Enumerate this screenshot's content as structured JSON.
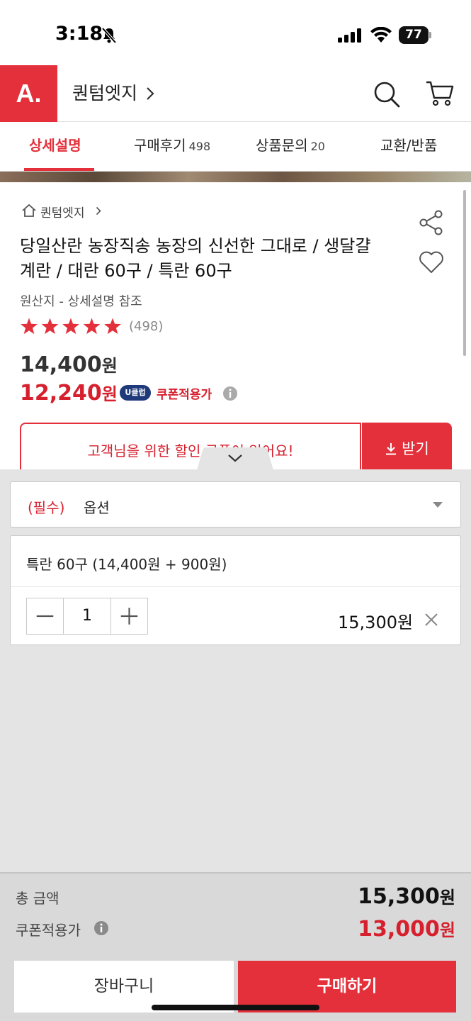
{
  "status_bar": {
    "time": "3:18",
    "battery": "77"
  },
  "header": {
    "store_name": "퀀텀엣지",
    "logo": "A."
  },
  "tabs": [
    {
      "label": "상세설명",
      "count": ""
    },
    {
      "label": "구매후기",
      "count": "498"
    },
    {
      "label": "상품문의",
      "count": "20"
    },
    {
      "label": "교환/반품",
      "count": ""
    }
  ],
  "product": {
    "breadcrumb": "퀀텀엣지",
    "title": "당일산란 농장직송 농장의 신선한 그대로 / 생달걀 계란 / 대란 60구 / 특란 60구",
    "origin": "원산지 - 상세설명 참조",
    "rating": 5,
    "review_count": "(498)",
    "original_price": "14,400",
    "sale_price": "12,240",
    "currency": "원",
    "badge": "U클럽",
    "coupon_applied_label": "쿠폰적용가",
    "coupon_banner": "고객님을 위한 할인 쿠폰이 있어요!",
    "coupon_button": "받기"
  },
  "options": {
    "required_tag": "(필수)",
    "option_label": "옵션",
    "selected": {
      "name": "특란 60구 (14,400원 + 900원)",
      "quantity": "1",
      "price": "15,300원"
    }
  },
  "totals": {
    "total_label": "총 금액",
    "total_value": "15,300",
    "coupon_label": "쿠폰적용가",
    "coupon_value": "13,000",
    "currency": "원"
  },
  "actions": {
    "cart": "장바구니",
    "buy": "구매하기"
  },
  "colors": {
    "brand": "#e4303b",
    "price_red": "#d6202e",
    "uclub_navy": "#1f3a7a"
  },
  "icons": [
    "bell-slash-icon",
    "signal-icon",
    "wifi-icon",
    "search-icon",
    "cart-icon",
    "home-icon",
    "share-icon",
    "heart-icon",
    "star-icon",
    "info-icon",
    "download-icon",
    "chevron-down-icon",
    "caret-down-icon",
    "minus-icon",
    "plus-icon",
    "close-icon"
  ]
}
